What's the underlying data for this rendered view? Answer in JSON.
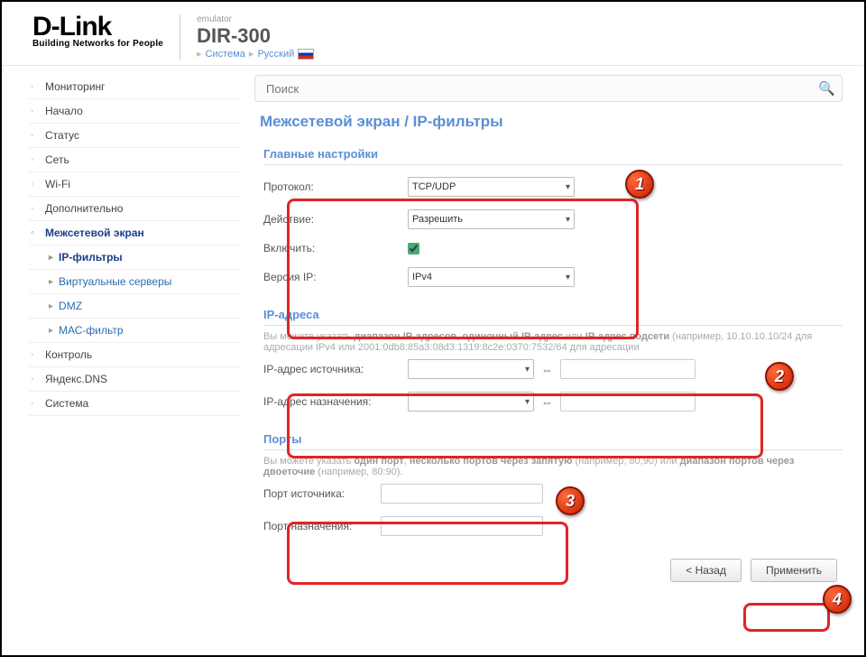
{
  "header": {
    "logo": "D-Link",
    "logo_sub": "Building Networks for People",
    "emulator_label": "emulator",
    "model": "DIR-300",
    "breadcrumb": {
      "item1": "Система",
      "item2": "Русский"
    }
  },
  "sidebar": {
    "items": [
      {
        "label": "Мониторинг"
      },
      {
        "label": "Начало"
      },
      {
        "label": "Статус"
      },
      {
        "label": "Сеть"
      },
      {
        "label": "Wi-Fi"
      },
      {
        "label": "Дополнительно"
      },
      {
        "label": "Межсетевой экран"
      },
      {
        "label": "Контроль"
      },
      {
        "label": "Яндекс.DNS"
      },
      {
        "label": "Система"
      }
    ],
    "firewall_subs": [
      {
        "label": "IP-фильтры"
      },
      {
        "label": "Виртуальные серверы"
      },
      {
        "label": "DMZ"
      },
      {
        "label": "МАС-фильтр"
      }
    ]
  },
  "search": {
    "placeholder": "Поиск"
  },
  "page": {
    "title": "Межсетевой экран /  IP-фильтры"
  },
  "sections": {
    "main": {
      "title": "Главные настройки",
      "protocol_label": "Протокол:",
      "protocol_value": "TCP/UDP",
      "action_label": "Действие:",
      "action_value": "Разрешить",
      "enable_label": "Включить:",
      "enable_checked": true,
      "ipver_label": "Версия IP:",
      "ipver_value": "IPv4"
    },
    "ips": {
      "title": "IP-адреса",
      "desc_pre": "Вы можете указать ",
      "desc_b1": "диапазон IP-адресов",
      "desc_mid1": ", ",
      "desc_b2": "одиночный IP-адрес",
      "desc_mid2": " или ",
      "desc_b3": "IP-адрес подсети",
      "desc_post": " (например, 10.10.10.10/24 для адресации IPv4 или 2001:0db8:85a3:08d3:1319:8c2e:0370:7532/64 для адресации",
      "src_label": "IP-адрес источника:",
      "dst_label": "IP-адрес назначения:"
    },
    "ports": {
      "title": "Порты",
      "desc_pre": "Вы можете указать ",
      "desc_b1": "один порт",
      "desc_mid1": ", ",
      "desc_b2": "несколько портов через запятую",
      "desc_mid2": " (например, 80,90) или ",
      "desc_b3": "диапазон портов через двоеточие",
      "desc_post": " (например, 80:90).",
      "src_label": "Порт источника:",
      "dst_label": "Порт назначения:"
    }
  },
  "buttons": {
    "back": "< Назад",
    "apply": "Применить"
  },
  "markers": {
    "m1": "1",
    "m2": "2",
    "m3": "3",
    "m4": "4"
  }
}
